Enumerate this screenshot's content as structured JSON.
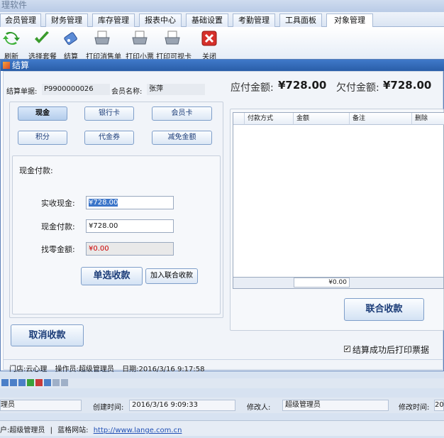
{
  "app": {
    "title": "理软件"
  },
  "menu": [
    "会员管理",
    "财务管理",
    "库存管理",
    "报表中心",
    "基础设置",
    "考勤管理",
    "工具面板",
    "对象管理"
  ],
  "toolbar": [
    {
      "label": "刷新",
      "icon": "refresh-icon"
    },
    {
      "label": "选择套餐",
      "icon": "check-icon"
    },
    {
      "label": "结算",
      "icon": "settle-icon"
    },
    {
      "label": "打印消售单",
      "icon": "printer-icon"
    },
    {
      "label": "打印小票",
      "icon": "printer-icon"
    },
    {
      "label": "打印可视卡",
      "icon": "printer-icon"
    },
    {
      "label": "关闭",
      "icon": "close-icon"
    }
  ],
  "dialog": {
    "title": "结算",
    "order_label": "结算单据:",
    "order_no": "P9900000026",
    "member_label": "会员名称:",
    "member_name": "张萍",
    "due_label": "应付金额:",
    "due_value": "¥728.00",
    "owed_label": "欠付金额:",
    "owed_value": "¥728.00",
    "pay_methods": [
      "现金",
      "银行卡",
      "会员卡",
      "积分",
      "代金券",
      "减免金额"
    ],
    "selected_method": "现金",
    "cash_title": "现金付款:",
    "received_label": "实收现金:",
    "received_value": "¥728.00",
    "cash_pay_label": "现金付款:",
    "cash_pay_value": "¥728.00",
    "change_label": "找零金额:",
    "change_value": "¥0.00",
    "single_btn": "单选收款",
    "add_combo_btn": "加入联合收款",
    "grid_headers": [
      "付款方式",
      "金额",
      "备注",
      "删除"
    ],
    "grid_total": "¥0.00",
    "combo_btn": "联合收款",
    "cancel_btn": "取消收款",
    "print_checkbox": "结算成功后打印票据",
    "footer": {
      "store_label": "门店:",
      "store": "云心理",
      "operator_label": "操作员:",
      "operator": "超级管理员",
      "date_label": "日期:",
      "date": "2016/3/16 9:17:58"
    }
  },
  "status1": {
    "c1": "理员",
    "created_label": "创建时间:",
    "created": "2016/3/16 9:09:33",
    "modifier_label": "修改人:",
    "modifier": "超级管理员",
    "modtime_label": "修改时间:",
    "modtime": "20"
  },
  "status2": {
    "user_prefix": "户:",
    "user": "超级管理员",
    "site_label": "蓝格网站:",
    "site": "http://www.lange.com.cn"
  }
}
